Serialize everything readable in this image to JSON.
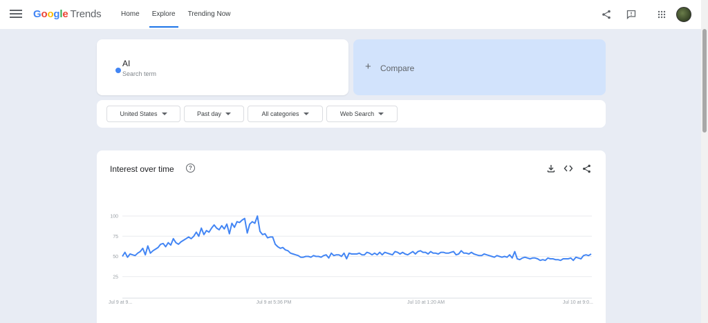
{
  "header": {
    "logo_google": [
      "G",
      "o",
      "o",
      "g",
      "l",
      "e"
    ],
    "logo_trends": "Trends",
    "nav": [
      {
        "label": "Home",
        "active": false
      },
      {
        "label": "Explore",
        "active": true
      },
      {
        "label": "Trending Now",
        "active": false
      }
    ],
    "icons": [
      "menu-icon",
      "share-icon",
      "feedback-icon",
      "apps-icon",
      "avatar"
    ]
  },
  "search": {
    "term": "AI",
    "term_sublabel": "Search term",
    "term_color": "#4285f4",
    "compare_label": "Compare"
  },
  "filters": [
    {
      "label": "United States"
    },
    {
      "label": "Past day"
    },
    {
      "label": "All categories"
    },
    {
      "label": "Web Search"
    }
  ],
  "interest": {
    "title": "Interest over time",
    "icons": [
      "help-icon",
      "download-icon",
      "embed-icon",
      "share-icon"
    ]
  },
  "chart_data": {
    "type": "line",
    "title": "",
    "xlabel": "",
    "ylabel": "",
    "ylim": [
      0,
      100
    ],
    "yticks": [
      "100",
      "75",
      "50",
      "25"
    ],
    "x_tick_labels": [
      "Jul 9 at 9...",
      "Jul 9 at 5:36 PM",
      "Jul 10 at 1:20 AM",
      "Jul 10 at 9:0..."
    ],
    "grid": true,
    "color": "#4285f4",
    "series": [
      {
        "values": [
          50,
          55,
          49,
          53,
          52,
          51,
          54,
          56,
          60,
          52,
          63,
          54,
          57,
          59,
          61,
          65,
          66,
          62,
          67,
          64,
          72,
          67,
          65,
          68,
          70,
          72,
          74,
          72,
          75,
          80,
          75,
          85,
          77,
          82,
          80,
          85,
          89,
          85,
          83,
          88,
          84,
          90,
          78,
          91,
          86,
          93,
          92,
          95,
          97,
          79,
          90,
          93,
          91,
          100,
          81,
          77,
          78,
          73,
          74,
          74,
          65,
          62,
          60,
          61,
          58,
          57,
          54,
          53,
          52,
          51,
          49,
          49,
          50,
          50,
          49,
          51,
          50,
          50,
          49,
          51,
          52,
          48,
          54,
          51,
          52,
          52,
          50,
          54,
          47,
          54,
          53,
          53,
          53,
          54,
          52,
          52,
          55,
          54,
          52,
          54,
          52,
          55,
          52,
          55,
          54,
          53,
          52,
          56,
          55,
          53,
          55,
          53,
          52,
          54,
          56,
          53,
          56,
          57,
          55,
          55,
          53,
          56,
          54,
          54,
          53,
          55,
          55,
          54,
          54,
          55,
          56,
          52,
          53,
          57,
          54,
          54,
          53,
          55,
          53,
          52,
          51,
          51,
          53,
          52,
          51,
          50,
          49,
          51,
          50,
          49,
          50,
          49,
          52,
          48,
          56,
          47,
          46,
          48,
          49,
          48,
          47,
          48,
          48,
          47,
          45,
          46,
          45,
          48,
          47,
          47,
          46,
          46,
          45,
          47,
          47,
          47,
          48,
          45,
          49,
          48,
          47,
          51,
          52,
          51,
          53
        ]
      }
    ]
  }
}
